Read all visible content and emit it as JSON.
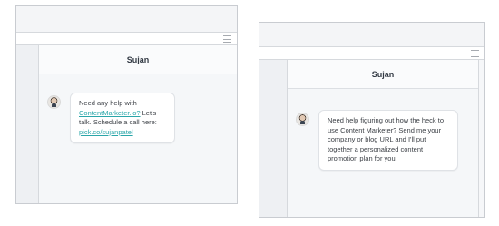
{
  "left_shot": {
    "contact_name": "Sujan",
    "message": {
      "part1": "Need any help with ",
      "link1": "ContentMarketer.io?",
      "part2": " Let's talk. Schedule a call here: ",
      "link2": "pick.co/sujanpatel"
    }
  },
  "right_shot": {
    "contact_name": "Sujan",
    "message": {
      "text": "Need help figuring out how the heck to use Content Marketer? Send me your company or blog URL and I'll put together a personalized content promotion plan for you."
    }
  },
  "colors": {
    "link": "#2aa6a9",
    "bubble_bg": "#ffffff",
    "panel_bg": "#f5f7f9"
  },
  "icons": {
    "menu": "hamburger-menu-icon",
    "avatar": "user-avatar"
  }
}
